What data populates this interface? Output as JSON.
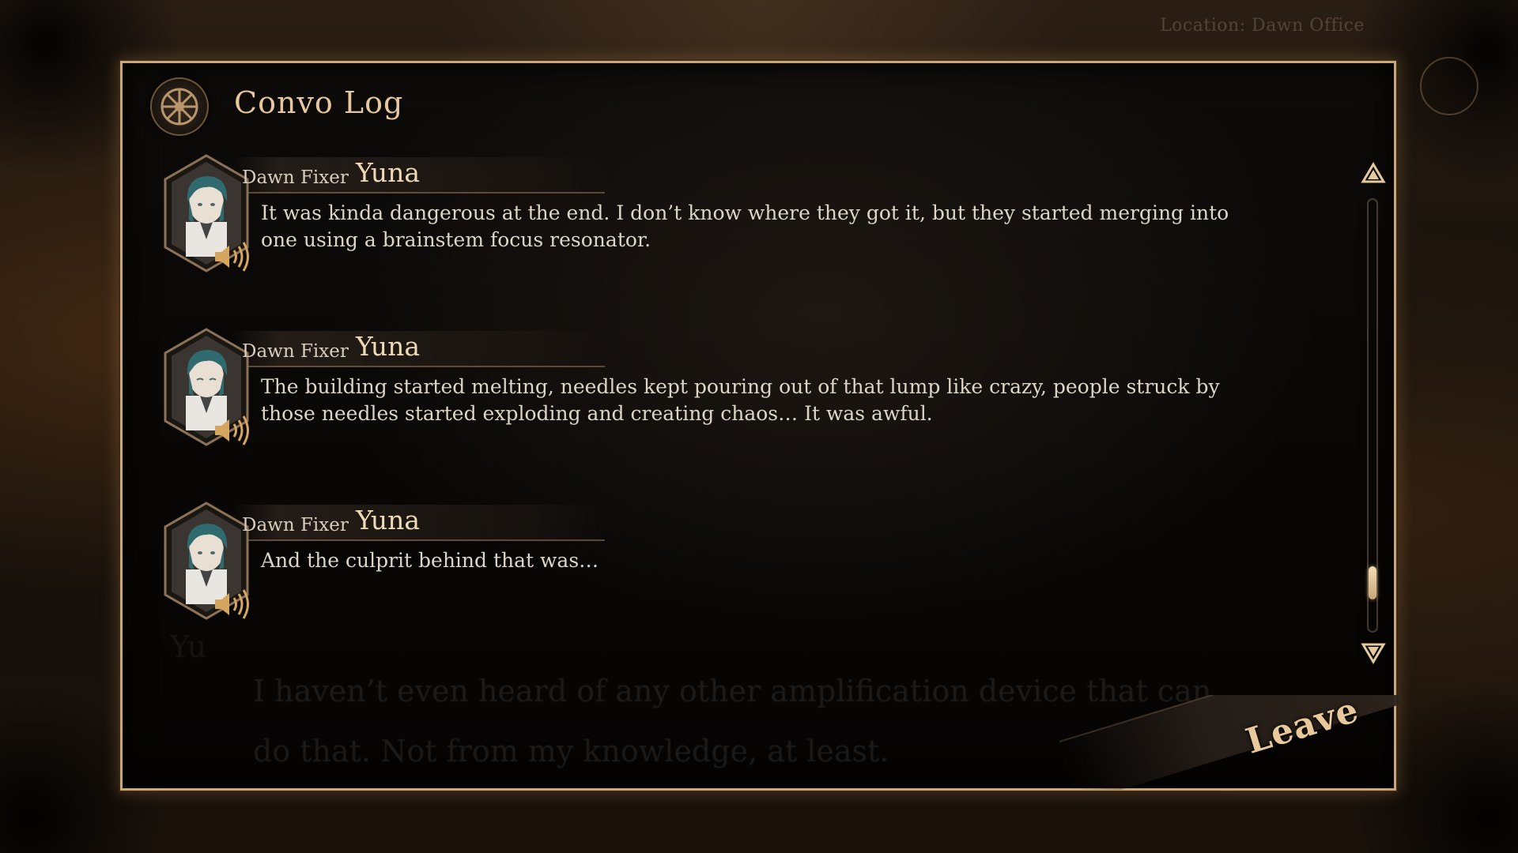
{
  "hud": {
    "location": "Location: Dawn Office"
  },
  "panel": {
    "title": "Convo Log"
  },
  "log": [
    {
      "affiliation": "Dawn Fixer",
      "speaker": "Yuna",
      "text": "It was kinda dangerous at the end. I don’t know where they got it, but they started merging into one using a brainstem focus resonator.",
      "voice_icon": "speaker-icon"
    },
    {
      "affiliation": "Dawn Fixer",
      "speaker": "Yuna",
      "text": "The building started melting, needles kept pouring out of that lump like crazy, people struck by those needles started exploding and creating chaos… It was awful.",
      "voice_icon": "speaker-icon"
    },
    {
      "affiliation": "Dawn Fixer",
      "speaker": "Yuna",
      "text": "And the culprit behind that was…",
      "voice_icon": "speaker-icon"
    }
  ],
  "background_dialogue": {
    "speaker": "Yu",
    "text": "I haven’t even heard of any other amplification device that can do that. Not from my knowledge, at least."
  },
  "scrollbar": {
    "up_icon": "triangle-up-icon",
    "down_icon": "triangle-down-icon",
    "position": 0.92
  },
  "actions": {
    "leave_label": "Leave"
  },
  "colors": {
    "frame_gold": "#c9a77a",
    "title": "#e8c79e",
    "body_text": "#ddd5c8",
    "hair_teal": "#2f6a6e"
  }
}
